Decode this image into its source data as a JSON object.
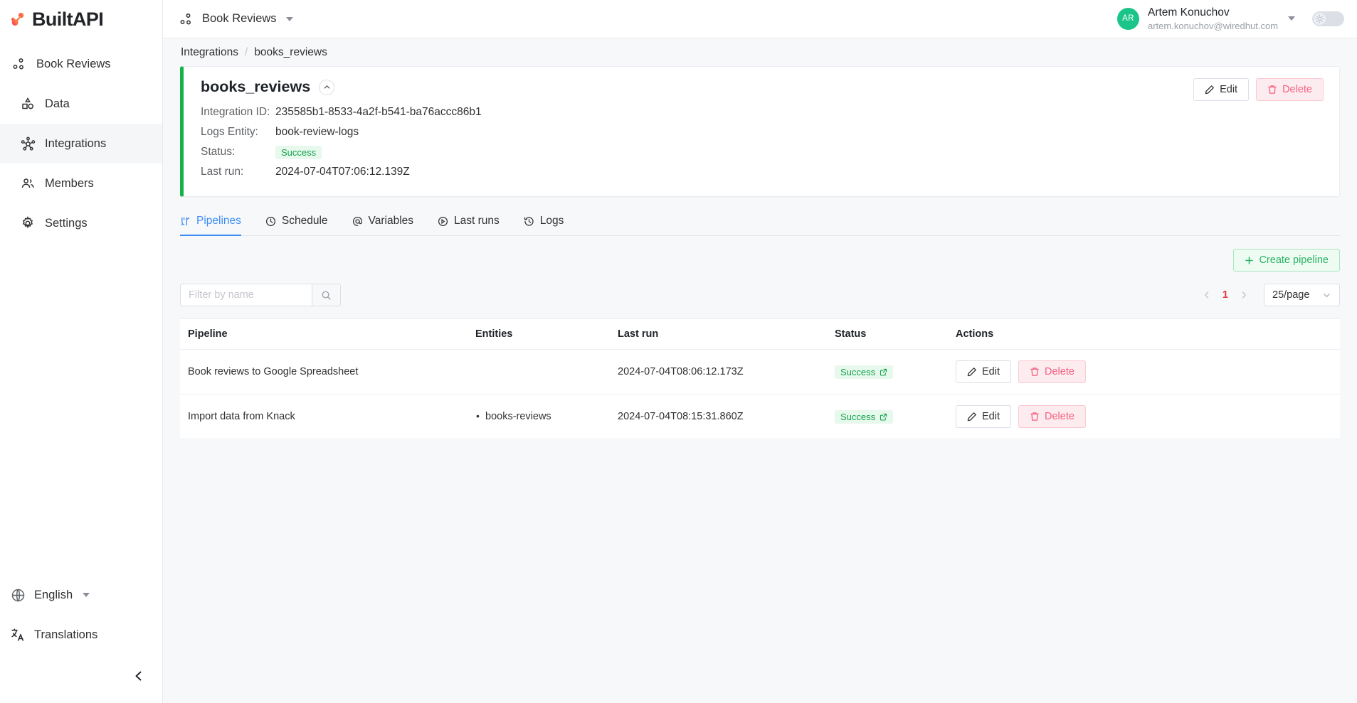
{
  "brand": {
    "name": "BuiltAPI",
    "logo_icon": "builtapi-logo-icon"
  },
  "sidebar": {
    "project": {
      "label": "Book Reviews",
      "icon": "project-nodes-icon"
    },
    "items": [
      {
        "label": "Data",
        "icon": "shapes-icon",
        "active": false
      },
      {
        "label": "Integrations",
        "icon": "integrations-nodes-icon",
        "active": true
      },
      {
        "label": "Members",
        "icon": "members-icon",
        "active": false
      },
      {
        "label": "Settings",
        "icon": "gear-icon",
        "active": false
      }
    ],
    "language": {
      "label": "English",
      "icon": "globe-icon"
    },
    "translations": {
      "label": "Translations",
      "icon": "translate-icon"
    },
    "collapse": {
      "icon": "chevron-left-icon"
    }
  },
  "topbar": {
    "project_selector": {
      "label": "Book Reviews",
      "icon": "project-nodes-icon"
    },
    "user": {
      "initials": "AR",
      "name": "Artem Konuchov",
      "email": "artem.konuchov@wiredhut.com"
    },
    "theme_toggle": {
      "icon": "sun-icon",
      "state": "light"
    }
  },
  "breadcrumb": {
    "parent": "Integrations",
    "separator": "/",
    "current": "books_reviews"
  },
  "detail": {
    "title": "books_reviews",
    "collapse_icon": "chevron-up-icon",
    "fields": [
      {
        "key": "Integration ID:",
        "value": "235585b1-8533-4a2f-b541-ba76accc86b1"
      },
      {
        "key": "Logs Entity:",
        "value": "book-review-logs"
      }
    ],
    "status_key": "Status:",
    "status_value": "Success",
    "lastrun_key": "Last run:",
    "lastrun_value": "2024-07-04T07:06:12.139Z",
    "edit_label": "Edit",
    "delete_label": "Delete",
    "accent_color": "#16b14b"
  },
  "tabs": [
    {
      "label": "Pipelines",
      "icon": "pipelines-icon",
      "active": true
    },
    {
      "label": "Schedule",
      "icon": "clock-icon",
      "active": false
    },
    {
      "label": "Variables",
      "icon": "at-icon",
      "active": false
    },
    {
      "label": "Last runs",
      "icon": "play-circle-icon",
      "active": false
    },
    {
      "label": "Logs",
      "icon": "history-icon",
      "active": false
    }
  ],
  "toolbar": {
    "create_label": "Create pipeline",
    "create_icon": "plus-icon",
    "filter_placeholder": "Filter by name",
    "filter_value": "",
    "search_icon": "search-icon",
    "prev_icon": "chevron-left-icon",
    "next_icon": "chevron-right-icon",
    "current_page": "1",
    "page_size": "25/page",
    "page_size_icon": "chevron-down-icon"
  },
  "table": {
    "columns": [
      "Pipeline",
      "Entities",
      "Last run",
      "Status",
      "Actions"
    ],
    "rows": [
      {
        "pipeline": "Book reviews to Google Spreadsheet",
        "entities": [],
        "last_run": "2024-07-04T08:06:12.173Z",
        "status": "Success",
        "status_icon": "external-link-icon",
        "edit_label": "Edit",
        "delete_label": "Delete"
      },
      {
        "pipeline": "Import data from Knack",
        "entities": [
          "books-reviews"
        ],
        "last_run": "2024-07-04T08:15:31.860Z",
        "status": "Success",
        "status_icon": "external-link-icon",
        "edit_label": "Edit",
        "delete_label": "Delete"
      }
    ]
  },
  "colors": {
    "accent_green": "#16b14b",
    "success_text": "#13a34a",
    "success_bg": "#e7f8ed",
    "danger_text": "#f4607f",
    "danger_bg": "#fdecef",
    "tab_active": "#3b8cf5",
    "page_active": "#e4393c",
    "avatar_bg": "#1bc58a"
  }
}
